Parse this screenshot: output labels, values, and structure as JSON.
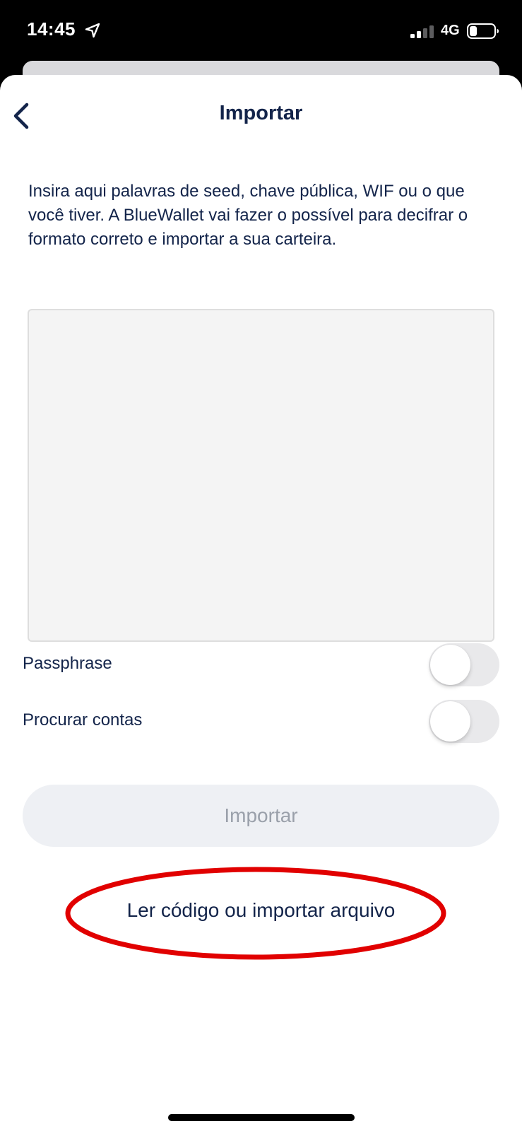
{
  "status_bar": {
    "time": "14:45",
    "network": "4G",
    "icons": {
      "location": "location-arrow-icon",
      "signal": "cellular-signal-icon",
      "battery": "battery-icon"
    }
  },
  "header": {
    "title": "Importar",
    "back_icon": "chevron-left-icon"
  },
  "description": "Insira aqui palavras de seed, chave pública, WIF ou o que você tiver. A BlueWallet vai fazer o possível para decifrar o formato correto e importar a sua carteira.",
  "seed_input": {
    "value": "",
    "placeholder": ""
  },
  "toggles": [
    {
      "label": "Passphrase",
      "on": false
    },
    {
      "label": "Procurar contas",
      "on": false
    }
  ],
  "import_button": {
    "label": "Importar",
    "enabled": false
  },
  "scan_link": {
    "label": "Ler código ou importar arquivo",
    "highlighted": true
  },
  "colors": {
    "text_primary": "#13244a",
    "button_disabled_bg": "#eef0f4",
    "button_disabled_text": "#9aa0aa",
    "input_bg": "#f4f4f4",
    "switch_off": "#e9e9eb",
    "highlight": "#e10000"
  }
}
